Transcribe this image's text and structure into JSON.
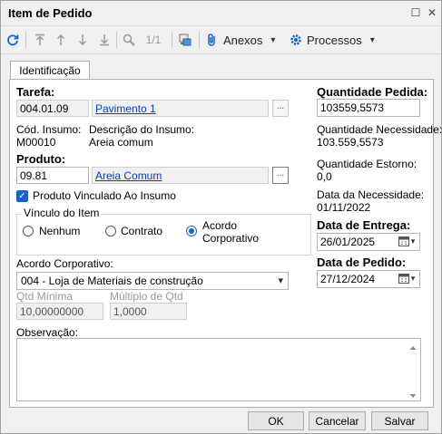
{
  "window": {
    "title": "Item de Pedido",
    "restore_glyph": "☐",
    "close_glyph": "✕"
  },
  "toolbar": {
    "page_indicator": "1/1",
    "anexos_label": "Anexos",
    "processos_label": "Processos"
  },
  "tabs": [
    {
      "label": "Identificação"
    }
  ],
  "form": {
    "tarefa": {
      "label": "Tarefa:",
      "code": "004.01.09",
      "description": "Pavimento 1"
    },
    "insumo": {
      "code_label": "Cód. Insumo:",
      "code_value": "M00010",
      "desc_label": "Descrição do Insumo:",
      "desc_value": "Areia comum"
    },
    "produto": {
      "label": "Produto:",
      "code": "09.81",
      "description": "Areia Comum"
    },
    "produto_vinculado": {
      "label": "Produto Vinculado Ao Insumo",
      "checked": true
    },
    "vinculo": {
      "legend": "Vínculo do Item",
      "options": [
        {
          "label": "Nenhum",
          "selected": false
        },
        {
          "label": "Contrato",
          "selected": false
        },
        {
          "label_line1": "Acordo",
          "label_line2": "Corporativo",
          "selected": true
        }
      ]
    },
    "acordo": {
      "label": "Acordo Corporativo:",
      "value": "004 - Loja de Materiais de construção"
    },
    "qtd_minima": {
      "label": "Qtd Mínima",
      "value": "10,00000000"
    },
    "multiplo": {
      "label": "Múltiplo de Qtd",
      "value": "1,0000"
    },
    "observacao": {
      "label": "Observação:",
      "value": ""
    },
    "quantidade_pedida": {
      "label": "Quantidade Pedida:",
      "value": "103559,5573"
    },
    "quantidade_necessidade": {
      "label": "Quantidade Necessidade:",
      "value": "103.559,5573"
    },
    "quantidade_estorno": {
      "label": "Quantidade Estorno:",
      "value": "0,0"
    },
    "data_necessidade": {
      "label": "Data da Necessidade:",
      "value": "01/11/2022"
    },
    "data_entrega": {
      "label": "Data de Entrega:",
      "value": "26/01/2025"
    },
    "data_pedido": {
      "label": "Data de Pedido:",
      "value": "27/12/2024"
    }
  },
  "buttons": {
    "ok": "OK",
    "cancel": "Cancelar",
    "save": "Salvar"
  },
  "glyphs": {
    "dots": "...",
    "dropdown": "▾",
    "check": "✓"
  }
}
